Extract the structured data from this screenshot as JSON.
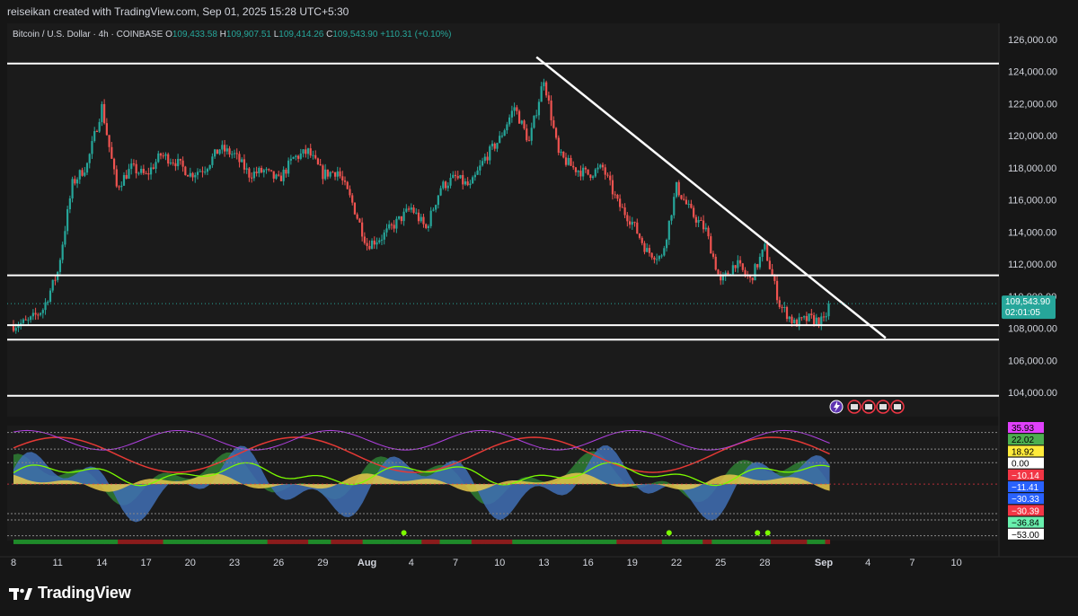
{
  "header": {
    "caption": "reiseikan created with TradingView.com, Sep 01, 2025 15:28 UTC+5:30"
  },
  "legend": {
    "symbol": "Bitcoin / U.S. Dollar · 4h · COINBASE",
    "o_label": "O",
    "o_value": "109,433.58",
    "h_label": "H",
    "h_value": "109,907.51",
    "l_label": "L",
    "l_value": "109,414.26",
    "c_label": "C",
    "c_value": "109,543.90",
    "change": "+110.31 (+0.10%)"
  },
  "price_badge": {
    "price": "109,543.90",
    "countdown": "02:01:05"
  },
  "brand": {
    "name": "TradingView"
  },
  "colors": {
    "background": "#161616",
    "up": "#26a69a",
    "down": "#ef5350",
    "lines": "#ffffff",
    "text": "#d1d4dc",
    "badge": "#26a69a"
  },
  "chart_data": {
    "type": "candlestick",
    "title": "Bitcoin / U.S. Dollar · 4h · COINBASE",
    "ylim": [
      102500,
      127000
    ],
    "y_ticks": [
      "126,000.00",
      "124,000.00",
      "122,000.00",
      "120,000.00",
      "118,000.00",
      "116,000.00",
      "114,000.00",
      "112,000.00",
      "110,000.00",
      "108,000.00",
      "106,000.00",
      "104,000.00"
    ],
    "y_tick_values": [
      126000,
      124000,
      122000,
      120000,
      118000,
      116000,
      114000,
      112000,
      110000,
      108000,
      106000,
      104000
    ],
    "x_ticks": [
      "8",
      "11",
      "14",
      "17",
      "20",
      "23",
      "26",
      "29",
      "Aug",
      "4",
      "7",
      "10",
      "13",
      "16",
      "19",
      "22",
      "25",
      "28",
      "Sep",
      "4",
      "7",
      "10"
    ],
    "x_tick_day_index": [
      0,
      3,
      6,
      9,
      12,
      15,
      18,
      21,
      24,
      27,
      30,
      33,
      36,
      39,
      42,
      45,
      48,
      51,
      55,
      58,
      61,
      64
    ],
    "close_anchors": [
      [
        0,
        108200
      ],
      [
        1,
        108400
      ],
      [
        2,
        109200
      ],
      [
        3,
        111500
      ],
      [
        4,
        117000
      ],
      [
        5,
        118200
      ],
      [
        6,
        121800
      ],
      [
        7,
        116800
      ],
      [
        8,
        118000
      ],
      [
        9,
        117500
      ],
      [
        10,
        118800
      ],
      [
        11,
        118400
      ],
      [
        12,
        117600
      ],
      [
        13,
        118000
      ],
      [
        14,
        119200
      ],
      [
        15,
        118800
      ],
      [
        16,
        117600
      ],
      [
        17,
        117800
      ],
      [
        18,
        117200
      ],
      [
        19,
        118600
      ],
      [
        20,
        119000
      ],
      [
        21,
        117600
      ],
      [
        22,
        117800
      ],
      [
        23,
        115800
      ],
      [
        24,
        113200
      ],
      [
        25,
        113700
      ],
      [
        26,
        114600
      ],
      [
        27,
        115500
      ],
      [
        28,
        114200
      ],
      [
        29,
        116800
      ],
      [
        30,
        117400
      ],
      [
        31,
        116800
      ],
      [
        32,
        118600
      ],
      [
        33,
        119800
      ],
      [
        34,
        121800
      ],
      [
        35,
        119600
      ],
      [
        36,
        123600
      ],
      [
        37,
        118800
      ],
      [
        38,
        118000
      ],
      [
        39,
        117600
      ],
      [
        40,
        118000
      ],
      [
        41,
        115800
      ],
      [
        42,
        114600
      ],
      [
        43,
        112800
      ],
      [
        44,
        112400
      ],
      [
        45,
        116800
      ],
      [
        46,
        115200
      ],
      [
        47,
        114100
      ],
      [
        48,
        110800
      ],
      [
        49,
        112100
      ],
      [
        50,
        111000
      ],
      [
        51,
        113000
      ],
      [
        52,
        109500
      ],
      [
        53,
        108300
      ],
      [
        54,
        108600
      ],
      [
        55,
        108400
      ],
      [
        55.4,
        109544
      ]
    ],
    "horizontal_levels": [
      124500,
      111300,
      108200,
      107300,
      103800
    ],
    "trendline": {
      "from": [
        35.5,
        124900
      ],
      "to": [
        59.2,
        107400
      ]
    },
    "last_price": 109543.9,
    "indicator": {
      "value_labels": [
        "35.93",
        "22.02",
        "18.92",
        "0.00",
        "−10.14",
        "−11.41",
        "−30.33",
        "−30.39",
        "−36.84",
        "−53.00"
      ],
      "label_colors": [
        "#e040fb",
        "#4caf50",
        "#ffeb3b",
        "#ffffff",
        "#f23645",
        "#2962ff",
        "#2962ff",
        "#f23645",
        "#69f0ae",
        "#ffffff"
      ],
      "label_text_colors": [
        "#000000",
        "#000000",
        "#000000",
        "#000000",
        "#ffffff",
        "#ffffff",
        "#ffffff",
        "#ffffff",
        "#000000",
        "#000000"
      ],
      "levels": [
        53,
        35.93,
        22.02,
        -30.39,
        -36.84,
        -53
      ],
      "ylim": [
        -58,
        60
      ]
    }
  }
}
